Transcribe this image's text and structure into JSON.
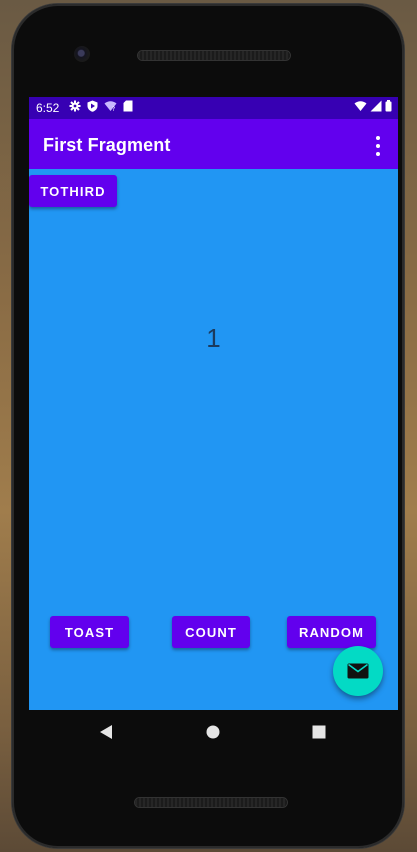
{
  "status_bar": {
    "time": "6:52",
    "icons_left": [
      "gear-icon",
      "shield-icon",
      "wifi-question-icon",
      "sd-card-icon"
    ],
    "icons_right": [
      "wifi-icon",
      "cell-signal-icon",
      "battery-icon"
    ]
  },
  "app_bar": {
    "title": "First Fragment",
    "menu_icon": "overflow-menu-icon"
  },
  "content": {
    "tothird_label": "TOTHIRD",
    "count_value": "1",
    "toast_label": "TOAST",
    "count_label": "COUNT",
    "random_label": "RANDOM"
  },
  "fab": {
    "icon": "mail-icon"
  },
  "nav_bar": {
    "buttons": [
      "back-icon",
      "home-icon",
      "recents-icon"
    ]
  },
  "colors": {
    "status_bar": "#3700b3",
    "app_bar": "#6200ee",
    "background": "#2196f3",
    "button": "#6200ee",
    "fab": "#03dac5"
  }
}
